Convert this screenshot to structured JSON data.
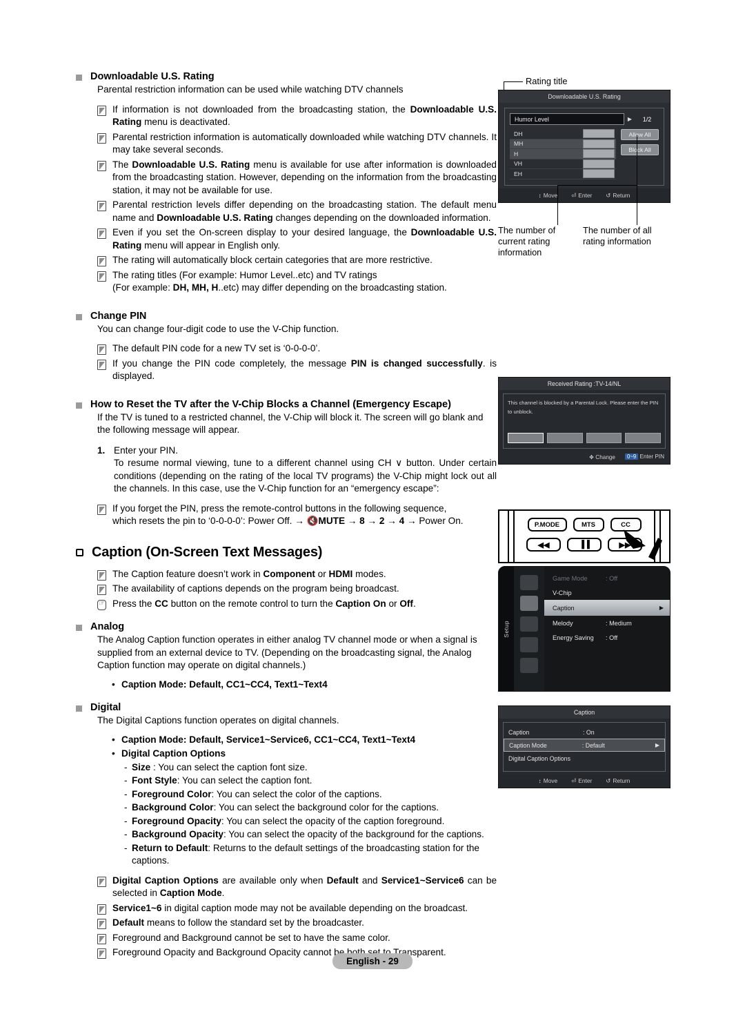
{
  "document": {
    "footer_label": "English - 29"
  },
  "sections": [
    {
      "id": "downloadable-us-rating",
      "heading": "Downloadable U.S. Rating",
      "intro": "Parental restriction information can be used while watching DTV channels",
      "notes": [
        "If information is not downloaded from the broadcasting station, the <b>Downloadable U.S. Rating</b> menu is deactivated.",
        "Parental restriction information is automatically downloaded while watching DTV channels. It may take several seconds.",
        "The <b>Downloadable U.S. Rating</b> menu is available for use after information is downloaded from the broadcasting station. However, depending on the information from the broadcasting station, it may not be available for use.",
        "Parental restriction levels differ depending on the broadcasting station. The default menu name and <b>Downloadable U.S. Rating</b> changes depending on the downloaded information.",
        "Even if you set the On-screen display to your desired language, the <b>Downloadable U.S. Rating</b> menu will appear in English only.",
        "The rating will automatically block certain categories that are more restrictive.",
        "The rating titles (For example: Humor Level..etc) and TV ratings<br>(For example: <b>DH, MH, H</b>..etc) may differ depending on the broadcasting station."
      ]
    },
    {
      "id": "change-pin",
      "heading": "Change PIN",
      "intro": "You can change four-digit code to use the V-Chip function.",
      "notes": [
        "The default PIN code for a new TV set is ‘0-0-0-0’.",
        "If you change the PIN code completely, the message <b>PIN is changed successfully</b>. is displayed."
      ]
    },
    {
      "id": "emergency-escape",
      "heading": "How to Reset the TV after the V-Chip Blocks a Channel (Emergency Escape)",
      "intro": "If the TV is tuned to a restricted channel, the V-Chip will block it. The screen will go blank and the following message will appear.",
      "numbered": [
        {
          "number": "1.",
          "text": "Enter your PIN.<br>To resume normal viewing, tune to a different channel using CH ∨ button. Under certain conditions (depending on the rating of the local TV programs) the V-Chip might lock out all the channels. In this case, use the V-Chip function for an “emergency escape”:"
        }
      ],
      "notes": [
        "If you forget the PIN, press the remote-control buttons in the following sequence,<br>which resets the pin to ‘0-0-0-0’: Power Off. → 🔇<b>MUTE</b> → <b>8</b> → <b>2</b> → <b>4</b> → Power On."
      ]
    },
    {
      "id": "caption",
      "heading": "Caption (On-Screen Text Messages)",
      "heading_style": "big",
      "notes": [
        "The Caption feature doesn’t work in <b>Component</b> or <b>HDMI</b> modes.",
        "The availability of captions depends on the program being broadcast.",
        "Press the <b>CC</b> button on the remote control to turn the <b>Caption On</b> or <b>Off</b>."
      ]
    },
    {
      "id": "analog",
      "heading": "Analog",
      "intro": "The Analog Caption function operates in either analog TV channel mode or when a signal is supplied from an external device to TV. (Depending on the broadcasting signal, the Analog Caption function may operate on digital channels.)",
      "bullets": [
        "<b>Caption Mode</b>: <b>Default, CC1~CC4, Text1~Text4</b>"
      ]
    },
    {
      "id": "digital",
      "heading": "Digital",
      "intro": "The Digital Captions function operates on digital channels.",
      "bullets": [
        "<b>Caption Mode</b>: <b>Default</b>, <b>Service1~Service6</b>, <b>CC1~CC4</b>, <b>Text1~Text4</b>",
        "<b>Digital Caption Options</b>"
      ],
      "dashes": [
        "<b>Size</b> : You can select the caption font size.",
        "<b>Font Style</b>: You can select the caption font.",
        "<b>Foreground Color</b>: You can select the color of the captions.",
        "<b>Background Color</b>: You can select the background color for the captions.",
        "<b>Foreground Opacity</b>: You can select the opacity of the caption foreground.",
        "<b>Background Opacity</b>: You can select the opacity of the background for the captions.",
        "<b>Return to Default</b>: Returns to the default settings of the broadcasting station for the captions."
      ],
      "notes": [
        "<b>Digital Caption Options</b> are available only when <b>Default</b> and <b>Service1~Service6</b> can be selected in <b>Caption Mode</b>.",
        "<b>Service1~6</b> in digital caption mode may not be available depending on the broadcast.",
        "<b>Default</b> means to follow the standard set by the broadcaster.",
        "Foreground and Background cannot be set to have the same color.",
        "Foreground Opacity and Background Opacity cannot be both set to Transparent."
      ]
    }
  ],
  "figures": {
    "rating_menu": {
      "callout_top": "Rating title",
      "title": "Downloadable U.S. Rating",
      "selected_title": "Humor Level",
      "page_indicator": "1/2",
      "arrow": "▶",
      "rows": [
        {
          "label": "DH"
        },
        {
          "label": "MH"
        },
        {
          "label": "H"
        },
        {
          "label": "VH"
        },
        {
          "label": "EH"
        }
      ],
      "side_buttons": [
        "Allow All",
        "Block All"
      ],
      "footer": [
        {
          "key": "↕",
          "label": "Move"
        },
        {
          "key": "⏎",
          "label": "Enter"
        },
        {
          "key": "↺",
          "label": "Return"
        }
      ],
      "callout_left": "The number of current rating information",
      "callout_right": "The number of all rating information"
    },
    "blocked_dialog": {
      "title": "Received Rating :TV-14/NL",
      "message": "This channel is blocked by a Parental Lock. Please enter the PIN to unblock.",
      "pin_boxes": 4,
      "footer": [
        {
          "key": "✥",
          "label": "Change"
        },
        {
          "key": "0~9",
          "label": "Enter  PIN"
        }
      ]
    },
    "remote": {
      "top_buttons": [
        "P.MODE",
        "MTS",
        "CC"
      ],
      "bottom_buttons": [
        "◀◀",
        "▐▐",
        "▶▶"
      ],
      "pointer_target": "CC"
    },
    "setup_menu": {
      "tab_label": "Setup",
      "items": [
        {
          "label": "Game Mode",
          "value": ": Off",
          "state": "dim"
        },
        {
          "label": "V-Chip",
          "value": "",
          "state": "normal"
        },
        {
          "label": "Caption",
          "value": "",
          "state": "highlight",
          "caret": "▶"
        },
        {
          "label": "Melody",
          "value": ": Medium",
          "state": "normal"
        },
        {
          "label": "Energy Saving",
          "value": ": Off",
          "state": "normal"
        }
      ]
    },
    "caption_menu": {
      "title": "Caption",
      "rows": [
        {
          "label": "Caption",
          "value": ": On",
          "state": "normal"
        },
        {
          "label": "Caption Mode",
          "value": ": Default",
          "state": "highlight",
          "caret": "▶"
        },
        {
          "label": "Digital Caption Options",
          "value": "",
          "state": "normal"
        }
      ],
      "footer": [
        {
          "key": "↕",
          "label": "Move"
        },
        {
          "key": "⏎",
          "label": "Enter"
        },
        {
          "key": "↺",
          "label": "Return"
        }
      ]
    }
  }
}
